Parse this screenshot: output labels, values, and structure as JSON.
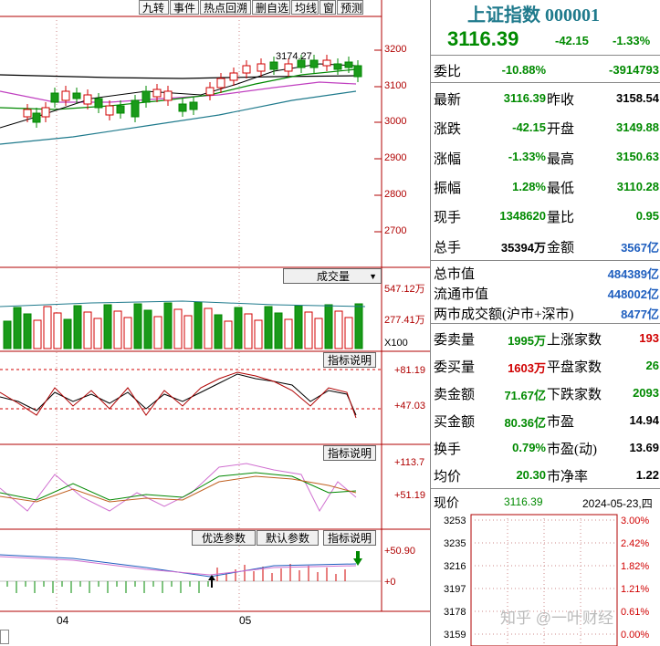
{
  "toolbar": {
    "items": [
      "九转",
      "事件",
      "热点回溯",
      "删自选",
      "均线",
      "窗",
      "预测"
    ],
    "icons": [
      "eye-icon",
      "hand-icon",
      "undo-icon",
      "pencil-icon",
      "lock-icon",
      "zoom-in-icon",
      "zoom-out-icon",
      "next-icon"
    ]
  },
  "price_panel": {
    "y_ticks": [
      "3200",
      "3100",
      "3000",
      "2900",
      "2800",
      "2700"
    ],
    "high_label": "3174.27"
  },
  "volume_panel": {
    "dropdown_label": "成交量",
    "y_ticks": [
      "547.12万",
      "277.41万",
      "X100"
    ]
  },
  "indicator1": {
    "button": "指标说明",
    "y_ticks": [
      "+81.19",
      "+47.03"
    ]
  },
  "indicator2": {
    "button": "指标说明",
    "y_ticks": [
      "+113.7",
      "+51.19"
    ]
  },
  "indicator3": {
    "buttons": [
      "优选参数",
      "默认参数",
      "指标说明"
    ],
    "y_ticks": [
      "+50.90",
      "+0"
    ]
  },
  "x_axis": {
    "labels": [
      "04",
      "05"
    ]
  },
  "quote": {
    "title": "上证指数",
    "code": "000001",
    "price": "3116.39",
    "change": "-42.15",
    "change_pct": "-1.33%",
    "colors": {
      "up": "#d00000",
      "down": "#008a00",
      "title": "#1f7a8c"
    },
    "weibi": {
      "label": "委比",
      "pct": "-10.88%",
      "diff": "-3914793"
    },
    "grid": [
      {
        "l1": "最新",
        "v1": "3116.39",
        "l2": "昨收",
        "v2": "3158.54",
        "c1": "g",
        "c2": "k"
      },
      {
        "l1": "涨跌",
        "v1": "-42.15",
        "l2": "开盘",
        "v2": "3149.88",
        "c1": "g",
        "c2": "g"
      },
      {
        "l1": "涨幅",
        "v1": "-1.33%",
        "l2": "最高",
        "v2": "3150.63",
        "c1": "g",
        "c2": "g"
      },
      {
        "l1": "振幅",
        "v1": "1.28%",
        "l2": "最低",
        "v2": "3110.28",
        "c1": "g",
        "c2": "g"
      },
      {
        "l1": "现手",
        "v1": "1348620",
        "l2": "量比",
        "v2": "0.95",
        "c1": "g",
        "c2": "g"
      },
      {
        "l1": "总手",
        "v1": "35394万",
        "l2": "金额",
        "v2": "3567亿",
        "c1": "k",
        "c2": "bl"
      }
    ],
    "market": [
      {
        "label": "总市值",
        "value": "484389亿"
      },
      {
        "label": "流通市值",
        "value": "448002亿"
      },
      {
        "label": "两市成交额(沪市+深市)",
        "value": "8477亿"
      }
    ],
    "grid2": [
      {
        "l1": "委卖量",
        "v1": "1995万",
        "l2": "上涨家数",
        "v2": "193",
        "c1": "g",
        "c2": "r"
      },
      {
        "l1": "委买量",
        "v1": "1603万",
        "l2": "平盘家数",
        "v2": "26",
        "c1": "r",
        "c2": "g"
      },
      {
        "l1": "卖金额",
        "v1": "71.67亿",
        "l2": "下跌家数",
        "v2": "2093",
        "c1": "g",
        "c2": "g"
      },
      {
        "l1": "买金额",
        "v1": "80.36亿",
        "l2": "市盈",
        "v2": "14.94",
        "c1": "g",
        "c2": "k"
      },
      {
        "l1": "换手",
        "v1": "0.79%",
        "l2": "市盈(动)",
        "v2": "13.69",
        "c1": "g",
        "c2": "k"
      },
      {
        "l1": "均价",
        "v1": "20.30",
        "l2": "市净率",
        "v2": "1.22",
        "c1": "g",
        "c2": "k"
      }
    ],
    "intraday": {
      "label": "现价",
      "price": "3116.39",
      "date": "2024-05-23,四",
      "left_ticks": [
        "3253",
        "3235",
        "3216",
        "3197",
        "3178",
        "3159"
      ],
      "right_ticks": [
        "3.00%",
        "2.42%",
        "1.82%",
        "1.21%",
        "0.61%",
        "0.00%"
      ]
    },
    "watermark": "知乎 @一叶财经"
  }
}
